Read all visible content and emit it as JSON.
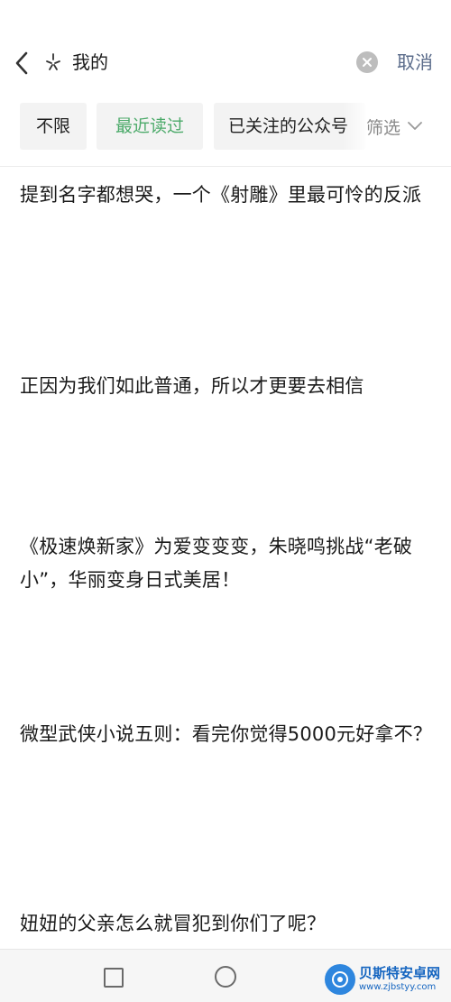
{
  "search": {
    "query": "我的",
    "cancel_label": "取消"
  },
  "icons": {
    "back": "chevron-left-icon",
    "sparkle": "sparkle-icon",
    "clear": "clear-circle-icon",
    "filter_chevron": "chevron-down-icon",
    "nav_recents": "square-icon",
    "nav_home": "circle-icon"
  },
  "filters": {
    "chips": [
      "不限",
      "最近读过",
      "已关注的公众号"
    ],
    "selected": "最近读过",
    "filter_label": "筛选"
  },
  "results": [
    "提到名字都想哭，一个《射雕》里最可怜的反派",
    "正因为我们如此普通，所以才更要去相信",
    "《极速焕新家》为爱变变变，朱晓鸣挑战“老破小”，华丽变身日式美居！",
    "微型武侠小说五则：看完你觉得5000元好拿不？",
    "妞妞的父亲怎么就冒犯到你们了呢？"
  ],
  "watermark": {
    "title": "贝斯特安卓网",
    "url": "www.zjbstyy.com"
  },
  "colors": {
    "accent_green": "#4caa6a",
    "cancel_blue_gray": "#5a6b8a",
    "watermark_blue": "#1565c0"
  }
}
